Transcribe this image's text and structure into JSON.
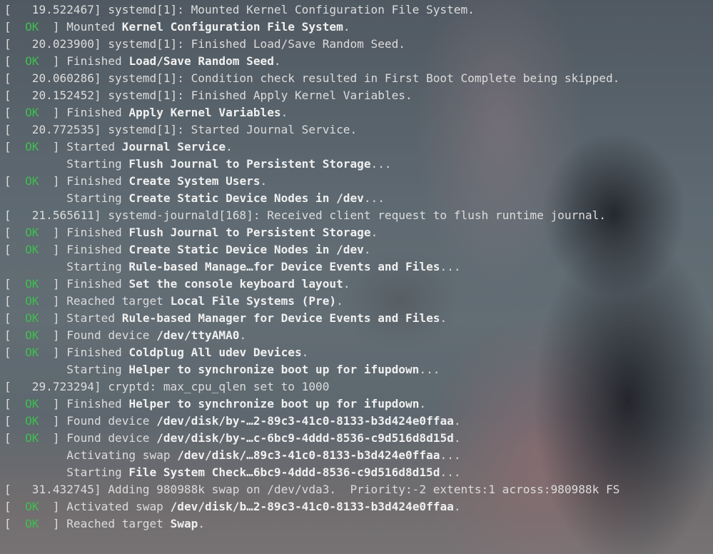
{
  "lines": [
    {
      "prefix": "[   19.522467] systemd[1]: Mounted Kernel Configuration File System.",
      "ok": "",
      "mid": "",
      "bold": "",
      "suffix": ""
    },
    {
      "prefix": "[  ",
      "ok": "OK",
      "mid": "  ] Mounted ",
      "bold": "Kernel Configuration File System",
      "suffix": "."
    },
    {
      "prefix": "[   20.023900] systemd[1]: Finished Load/Save Random Seed.",
      "ok": "",
      "mid": "",
      "bold": "",
      "suffix": ""
    },
    {
      "prefix": "[  ",
      "ok": "OK",
      "mid": "  ] Finished ",
      "bold": "Load/Save Random Seed",
      "suffix": "."
    },
    {
      "prefix": "[   20.060286] systemd[1]: Condition check resulted in First Boot Complete being skipped.",
      "ok": "",
      "mid": "",
      "bold": "",
      "suffix": ""
    },
    {
      "prefix": "[   20.152452] systemd[1]: Finished Apply Kernel Variables.",
      "ok": "",
      "mid": "",
      "bold": "",
      "suffix": ""
    },
    {
      "prefix": "[  ",
      "ok": "OK",
      "mid": "  ] Finished ",
      "bold": "Apply Kernel Variables",
      "suffix": "."
    },
    {
      "prefix": "[   20.772535] systemd[1]: Started Journal Service.",
      "ok": "",
      "mid": "",
      "bold": "",
      "suffix": ""
    },
    {
      "prefix": "[  ",
      "ok": "OK",
      "mid": "  ] Started ",
      "bold": "Journal Service",
      "suffix": "."
    },
    {
      "prefix": "         Starting ",
      "ok": "",
      "mid": "",
      "bold": "Flush Journal to Persistent Storage",
      "suffix": "..."
    },
    {
      "prefix": "[  ",
      "ok": "OK",
      "mid": "  ] Finished ",
      "bold": "Create System Users",
      "suffix": "."
    },
    {
      "prefix": "         Starting ",
      "ok": "",
      "mid": "",
      "bold": "Create Static Device Nodes in /dev",
      "suffix": "..."
    },
    {
      "prefix": "[   21.565611] systemd-journald[168]: Received client request to flush runtime journal.",
      "ok": "",
      "mid": "",
      "bold": "",
      "suffix": ""
    },
    {
      "prefix": "[  ",
      "ok": "OK",
      "mid": "  ] Finished ",
      "bold": "Flush Journal to Persistent Storage",
      "suffix": "."
    },
    {
      "prefix": "[  ",
      "ok": "OK",
      "mid": "  ] Finished ",
      "bold": "Create Static Device Nodes in /dev",
      "suffix": "."
    },
    {
      "prefix": "         Starting ",
      "ok": "",
      "mid": "",
      "bold": "Rule-based Manage…for Device Events and Files",
      "suffix": "..."
    },
    {
      "prefix": "[  ",
      "ok": "OK",
      "mid": "  ] Finished ",
      "bold": "Set the console keyboard layout",
      "suffix": "."
    },
    {
      "prefix": "[  ",
      "ok": "OK",
      "mid": "  ] Reached target ",
      "bold": "Local File Systems (Pre)",
      "suffix": "."
    },
    {
      "prefix": "[  ",
      "ok": "OK",
      "mid": "  ] Started ",
      "bold": "Rule-based Manager for Device Events and Files",
      "suffix": "."
    },
    {
      "prefix": "[  ",
      "ok": "OK",
      "mid": "  ] Found device ",
      "bold": "/dev/ttyAMA0",
      "suffix": "."
    },
    {
      "prefix": "[  ",
      "ok": "OK",
      "mid": "  ] Finished ",
      "bold": "Coldplug All udev Devices",
      "suffix": "."
    },
    {
      "prefix": "         Starting ",
      "ok": "",
      "mid": "",
      "bold": "Helper to synchronize boot up for ifupdown",
      "suffix": "..."
    },
    {
      "prefix": "[   29.723294] cryptd: max_cpu_qlen set to 1000",
      "ok": "",
      "mid": "",
      "bold": "",
      "suffix": ""
    },
    {
      "prefix": "[  ",
      "ok": "OK",
      "mid": "  ] Finished ",
      "bold": "Helper to synchronize boot up for ifupdown",
      "suffix": "."
    },
    {
      "prefix": "[  ",
      "ok": "OK",
      "mid": "  ] Found device ",
      "bold": "/dev/disk/by-…2-89c3-41c0-8133-b3d424e0ffaa",
      "suffix": "."
    },
    {
      "prefix": "[  ",
      "ok": "OK",
      "mid": "  ] Found device ",
      "bold": "/dev/disk/by-…c-6bc9-4ddd-8536-c9d516d8d15d",
      "suffix": "."
    },
    {
      "prefix": "         Activating swap ",
      "ok": "",
      "mid": "",
      "bold": "/dev/disk/…89c3-41c0-8133-b3d424e0ffaa",
      "suffix": "..."
    },
    {
      "prefix": "         Starting ",
      "ok": "",
      "mid": "",
      "bold": "File System Check…6bc9-4ddd-8536-c9d516d8d15d",
      "suffix": "..."
    },
    {
      "prefix": "[   31.432745] Adding 980988k swap on /dev/vda3.  Priority:-2 extents:1 across:980988k FS",
      "ok": "",
      "mid": "",
      "bold": "",
      "suffix": ""
    },
    {
      "prefix": "[  ",
      "ok": "OK",
      "mid": "  ] Activated swap ",
      "bold": "/dev/disk/b…2-89c3-41c0-8133-b3d424e0ffaa",
      "suffix": "."
    },
    {
      "prefix": "[  ",
      "ok": "OK",
      "mid": "  ] Reached target ",
      "bold": "Swap",
      "suffix": "."
    }
  ],
  "colors": {
    "ok": "#3fbf4f",
    "text": "#dcdcdc",
    "bold": "#f0f0f0"
  }
}
